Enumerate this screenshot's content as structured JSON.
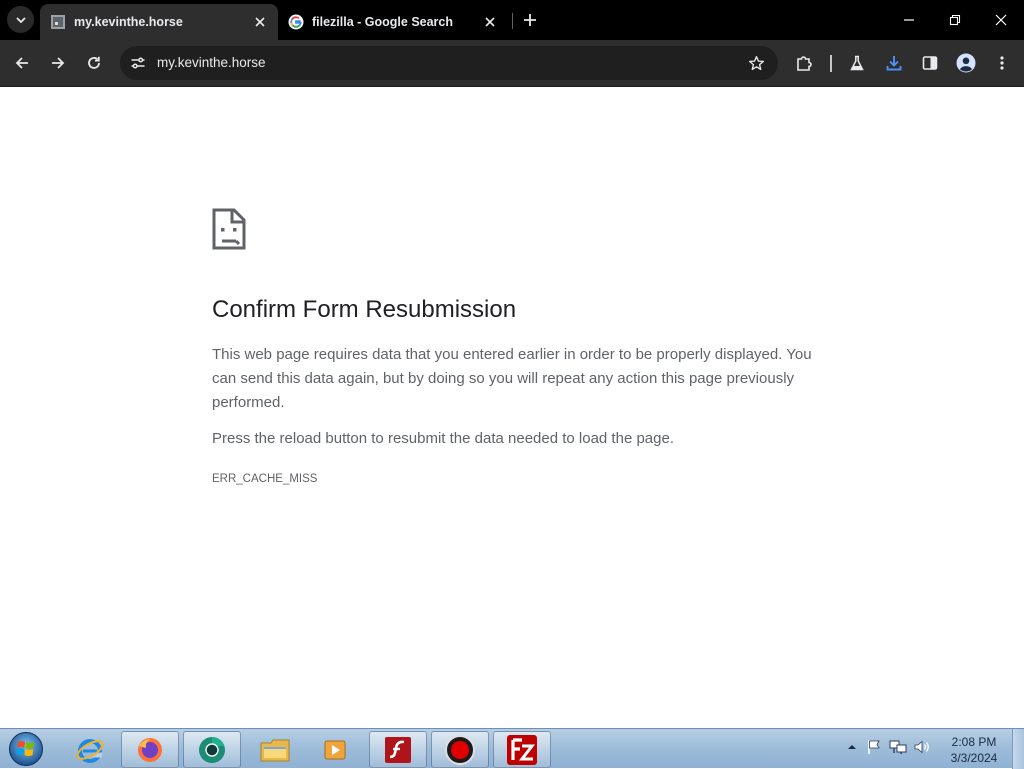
{
  "browser": {
    "tabs": [
      {
        "title": "my.kevinthe.horse",
        "active": true,
        "favicon": "page-icon"
      },
      {
        "title": "filezilla - Google Search",
        "active": false,
        "favicon": "google-g-icon"
      }
    ],
    "omnibox": {
      "url": "my.kevinthe.horse"
    }
  },
  "page": {
    "icon": "sad-page-icon",
    "title": "Confirm Form Resubmission",
    "description": "This web page requires data that you entered earlier in order to be properly displayed. You can send this data again, but by doing so you will repeat any action this page previously performed.",
    "hint": "Press the reload button to resubmit the data needed to load the page.",
    "error_code": "ERR_CACHE_MISS"
  },
  "taskbar": {
    "apps": [
      {
        "name": "internet-explorer-icon",
        "running": false
      },
      {
        "name": "firefox-icon",
        "running": true
      },
      {
        "name": "chrome-like-icon",
        "running": true
      },
      {
        "name": "file-explorer-icon",
        "running": false
      },
      {
        "name": "media-player-icon",
        "running": false
      },
      {
        "name": "flash-icon",
        "running": true
      },
      {
        "name": "record-icon",
        "running": true
      },
      {
        "name": "filezilla-icon",
        "running": true
      }
    ],
    "clock": {
      "time": "2:08 PM",
      "date": "3/3/2024"
    }
  },
  "colors": {
    "tab_strip": "#000000",
    "toolbar": "#2e2e2e",
    "omnibox": "#1f1f1f",
    "download_accent": "#4f8ff7",
    "taskbar": "#9dbcd9"
  }
}
